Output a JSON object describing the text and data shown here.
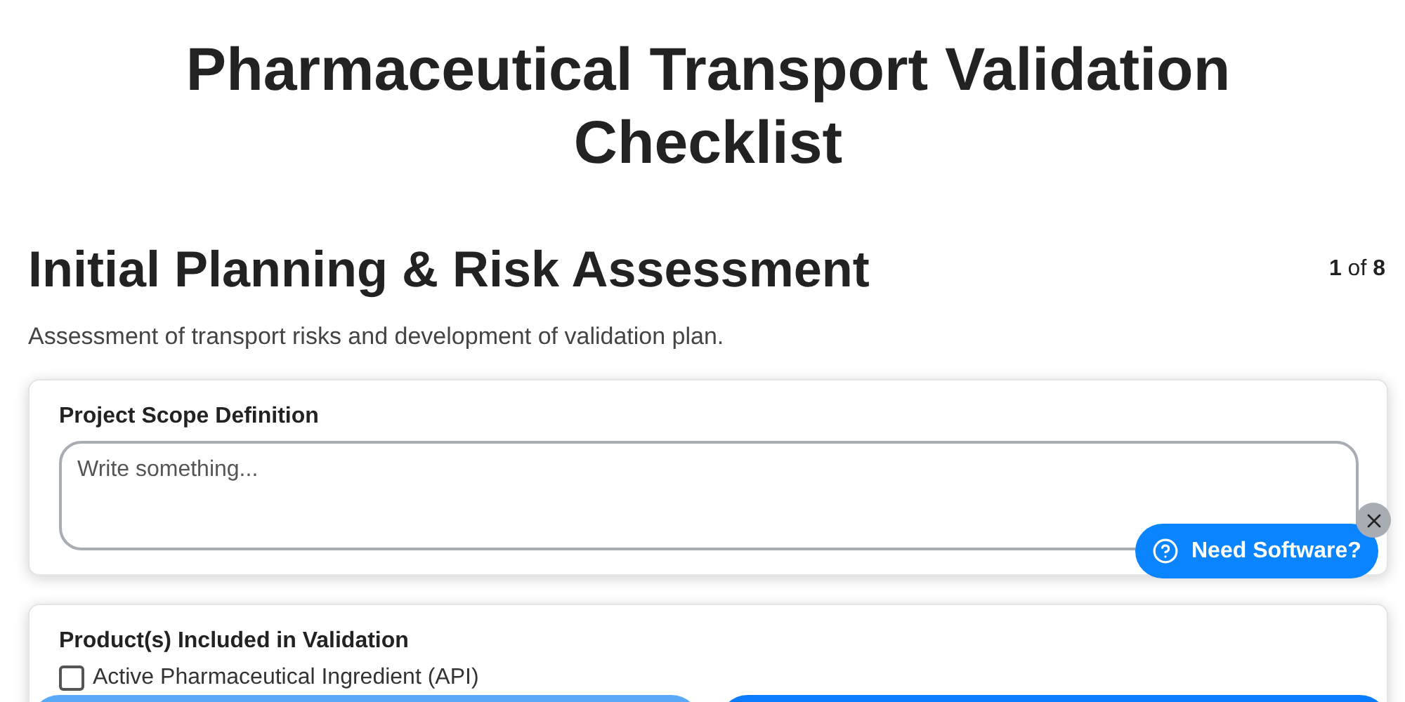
{
  "title": "Pharmaceutical Transport Validation Checklist",
  "step": {
    "title": "Initial Planning & Risk Assessment",
    "current": "1",
    "separator": "of",
    "total": "8",
    "description": "Assessment of transport risks and development of validation plan."
  },
  "fields": [
    {
      "kind": "textarea",
      "label": "Project Scope Definition",
      "placeholder": "Write something..."
    },
    {
      "kind": "checkboxes",
      "label": "Product(s) Included in Validation",
      "options": [
        {
          "label": "Active Pharmaceutical Ingredient (API)",
          "checked": false
        }
      ]
    }
  ],
  "help_widget": {
    "label": "Need Software?"
  }
}
